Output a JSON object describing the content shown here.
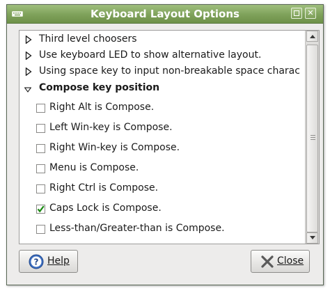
{
  "window": {
    "title": "Keyboard Layout Options"
  },
  "tree": {
    "rows": [
      {
        "label": "Third level choosers",
        "expanded": false
      },
      {
        "label": "Use keyboard LED to show alternative layout.",
        "expanded": false
      },
      {
        "label": "Using space key to input non-breakable space character",
        "expanded": false
      },
      {
        "label": "Compose key position",
        "expanded": true
      }
    ],
    "options": [
      {
        "label": "Right Alt is Compose.",
        "checked": false
      },
      {
        "label": "Left Win-key is Compose.",
        "checked": false
      },
      {
        "label": "Right Win-key is Compose.",
        "checked": false
      },
      {
        "label": "Menu is Compose.",
        "checked": false
      },
      {
        "label": "Right Ctrl is Compose.",
        "checked": false
      },
      {
        "label": "Caps Lock is Compose.",
        "checked": true
      },
      {
        "label": "Less-than/Greater-than is Compose.",
        "checked": false
      }
    ]
  },
  "buttons": {
    "help_label": "Help",
    "close_label": "Close"
  },
  "icons": {
    "app": "keyboard-icon",
    "maximize": "maximize-icon",
    "close": "close-icon",
    "help": "help-icon",
    "close_button": "close-x-icon"
  },
  "colors": {
    "titlebar": "#7ea15a",
    "check_mark": "#1a8a12"
  }
}
